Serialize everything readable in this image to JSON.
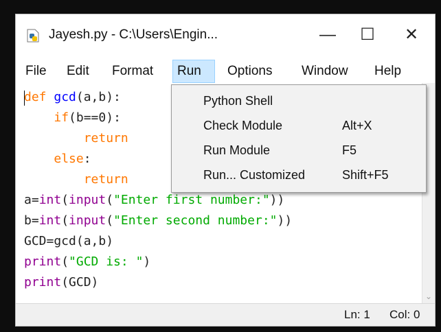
{
  "window": {
    "title": "Jayesh.py - C:\\Users\\Engin...",
    "minimize_glyph": "—",
    "maximize_glyph": "☐",
    "close_glyph": "✕"
  },
  "menubar": {
    "items": [
      "File",
      "Edit",
      "Format",
      "Run",
      "Options",
      "Window",
      "Help"
    ],
    "active": "Run"
  },
  "run_menu": {
    "items": [
      {
        "label": "Python Shell",
        "accel": ""
      },
      {
        "label": "Check Module",
        "accel": "Alt+X"
      },
      {
        "label": "Run Module",
        "accel": "F5"
      },
      {
        "label": "Run... Customized",
        "accel": "Shift+F5"
      }
    ]
  },
  "code": {
    "l1": {
      "kw": "def",
      "name": "gcd",
      "rest": "(a,b):"
    },
    "l2": {
      "indent": "    ",
      "kw": "if",
      "rest": "(b==0):"
    },
    "l3": {
      "indent": "        ",
      "kw": "return"
    },
    "l4": {
      "indent": "    ",
      "kw": "else",
      "rest": ":"
    },
    "l5": {
      "indent": "        ",
      "kw": "return"
    },
    "l6": {
      "a": "a=",
      "b1": "int",
      "p1": "(",
      "b2": "input",
      "p2": "(",
      "s": "\"Enter first number:\"",
      "p3": "))"
    },
    "l7": {
      "a": "b=",
      "b1": "int",
      "p1": "(",
      "b2": "input",
      "p2": "(",
      "s": "\"Enter second number:\"",
      "p3": "))"
    },
    "l8": {
      "text": "GCD=gcd(a,b)"
    },
    "l9": {
      "b": "print",
      "p1": "(",
      "s": "\"GCD is: \"",
      "p2": ")"
    },
    "l10": {
      "b": "print",
      "rest": "(GCD)"
    }
  },
  "status": {
    "line": "Ln: 1",
    "col": "Col: 0"
  },
  "colors": {
    "keyword": "#ff7700",
    "builtin": "#900090",
    "string": "#00aa00",
    "definition": "#0000ff",
    "menu_highlight": "#cce8ff"
  }
}
